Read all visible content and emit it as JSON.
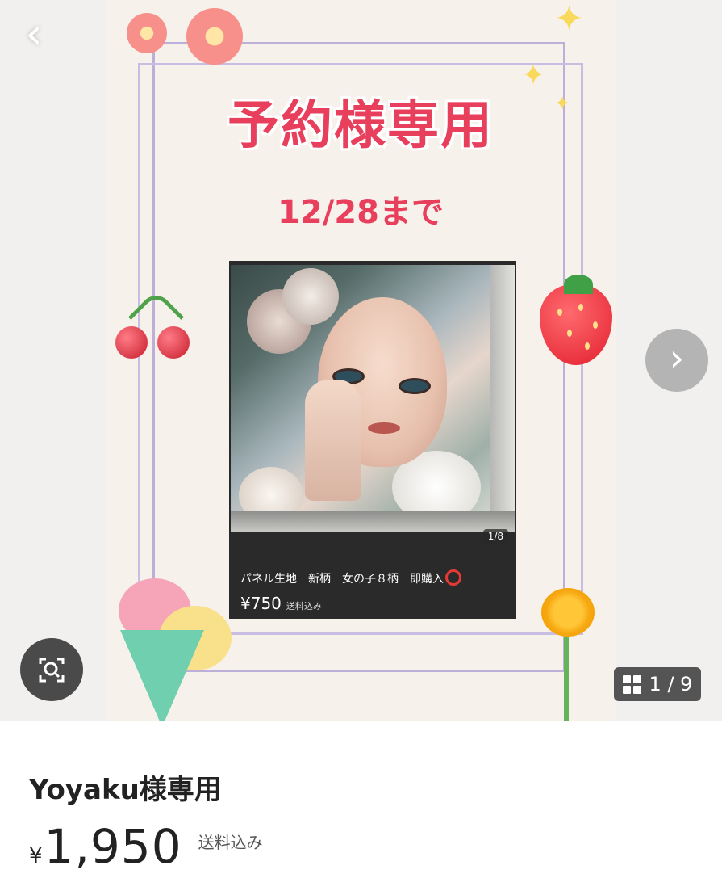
{
  "poster": {
    "title": "予約様専用",
    "date": "12/28まで",
    "inner_listing": {
      "counter": "1/8",
      "caption": "パネル生地　新柄　女の子８柄　即購入",
      "price": "¥750",
      "shipping": "送料込み"
    }
  },
  "gallery": {
    "back_label": "‹",
    "next_label": "›",
    "counter": "1 / 9"
  },
  "listing": {
    "title": "Yoyaku様専用",
    "currency": "¥",
    "price": "1,950",
    "shipping": "送料込み"
  },
  "colors": {
    "title_red": "#e8405c",
    "frame_lavender": "#bcb0d8",
    "overlay_dark": "#4a4a4a"
  },
  "icons": [
    "back-chevron-icon",
    "next-chevron-icon",
    "image-search-icon",
    "grid-icon"
  ]
}
